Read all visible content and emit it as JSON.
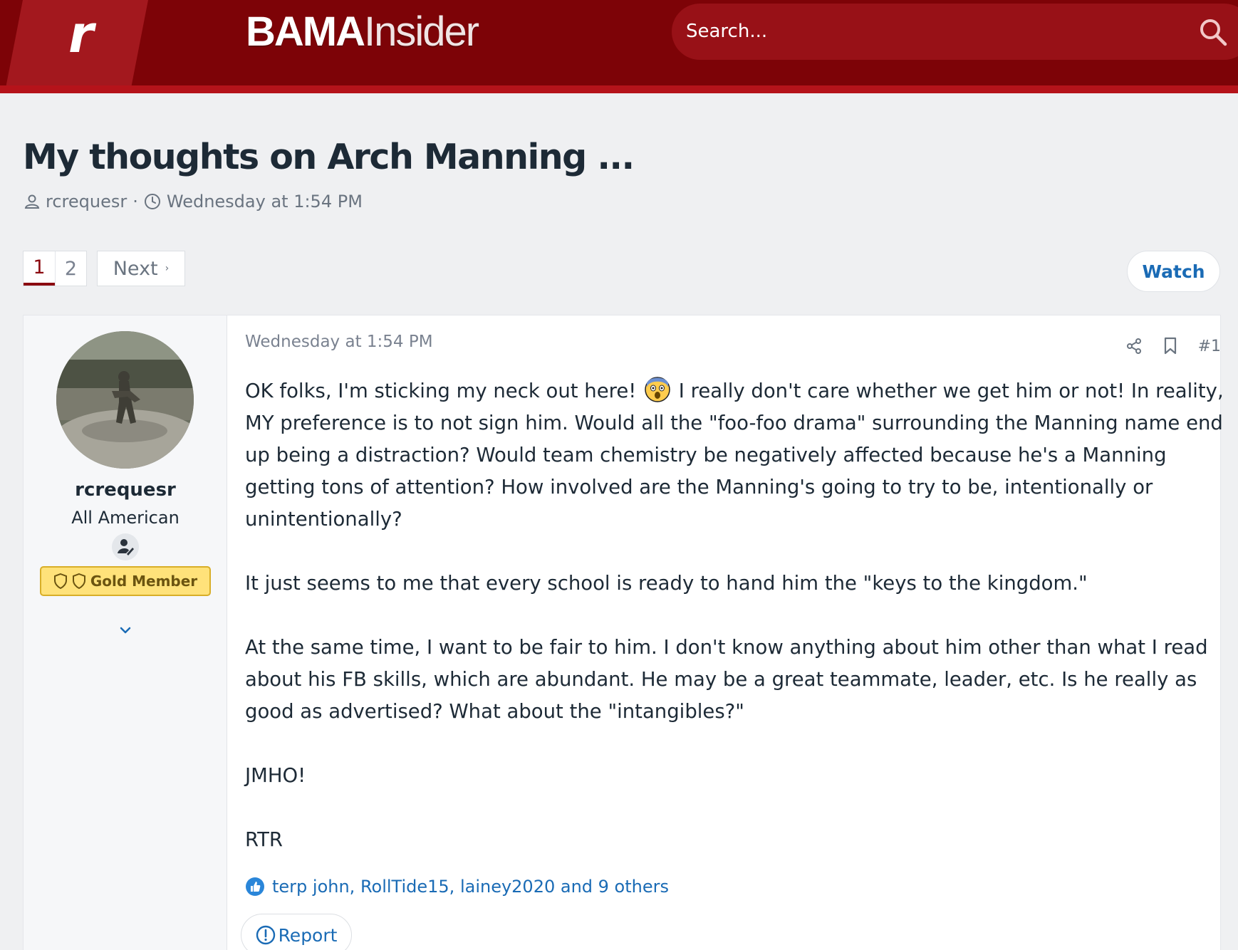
{
  "header": {
    "logo_letter": "r",
    "brand_bold": "BAMA",
    "brand_light": "Insider",
    "search_placeholder": "Search..."
  },
  "thread": {
    "title": "My thoughts on Arch Manning ...",
    "author": "rcrequesr",
    "separator": "·",
    "date": "Wednesday at 1:54 PM"
  },
  "pagination": {
    "pages": [
      "1",
      "2"
    ],
    "current": "1",
    "next_label": "Next",
    "next_caret": "›"
  },
  "watch_label": "Watch",
  "post": {
    "user": {
      "name": "rcrequesr",
      "title": "All American",
      "badge_label": "Gold Member"
    },
    "date": "Wednesday at 1:54 PM",
    "number": "#1",
    "paragraphs": [
      {
        "before_emoji": "OK folks, I'm sticking my neck out here! ",
        "after_emoji": " I really don't care whether we get him or not! In reality, MY preference is to not sign him. Would all the \"foo-foo drama\" surrounding the Manning name end up being a distraction? Would team chemistry be negatively affected because he's a Manning getting tons of attention? How involved are the Manning's going to try to be, intentionally or unintentionally?"
      },
      {
        "text": "It just seems to me that every school is ready to hand him the \"keys to the kingdom.\""
      },
      {
        "text": "At the same time, I want to be fair to him. I don't know anything about him other than what I read about his FB skills, which are abundant. He may be a great teammate, leader, etc. Is he really as good as advertised? What about the \"intangibles?\""
      },
      {
        "text": "JMHO!"
      },
      {
        "text": "RTR"
      }
    ],
    "reactions": "terp john, RollTide15, lainey2020 and 9 others",
    "report_label": "Report"
  },
  "colors": {
    "header_bg": "#7d0307",
    "header_stripe": "#b5131a",
    "accent_link": "#1a6bb5",
    "page_active": "#8b0a10",
    "gold_badge": "#ffe27a"
  },
  "icons": [
    "search-icon",
    "user-icon",
    "clock-icon",
    "share-icon",
    "bookmark-icon",
    "pen-icon",
    "shield-icon",
    "chevron-down-icon",
    "like-icon",
    "alert-icon",
    "shocked-emoji-icon"
  ]
}
